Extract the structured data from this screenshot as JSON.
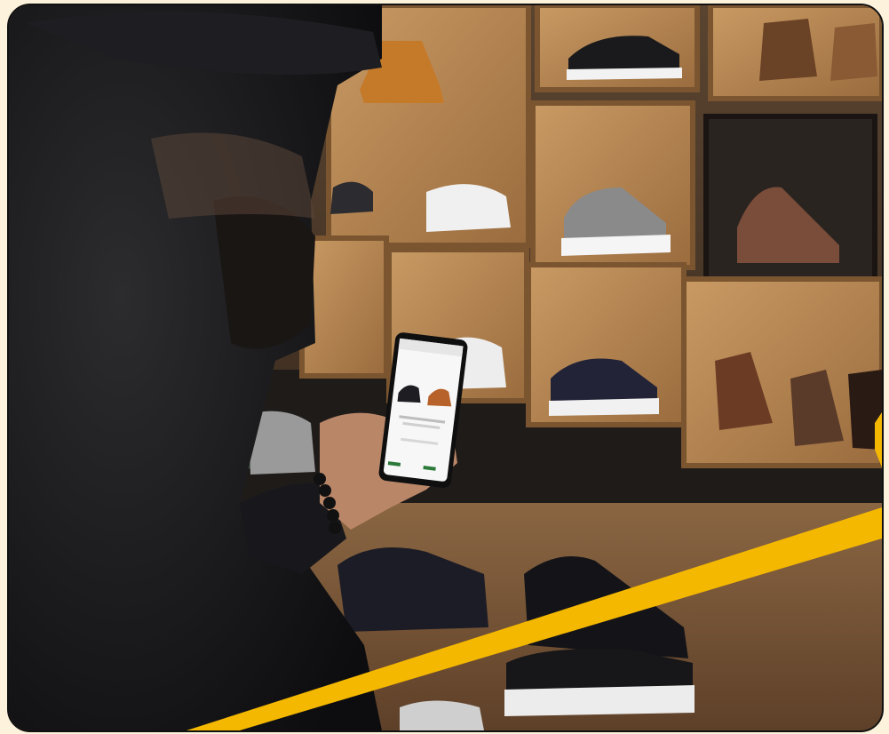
{
  "image": {
    "alt": "",
    "accent_color": "#f5b800",
    "border_color": "#111111",
    "background_color": "#fdf3dc"
  },
  "phone": {
    "cta_label": ""
  }
}
